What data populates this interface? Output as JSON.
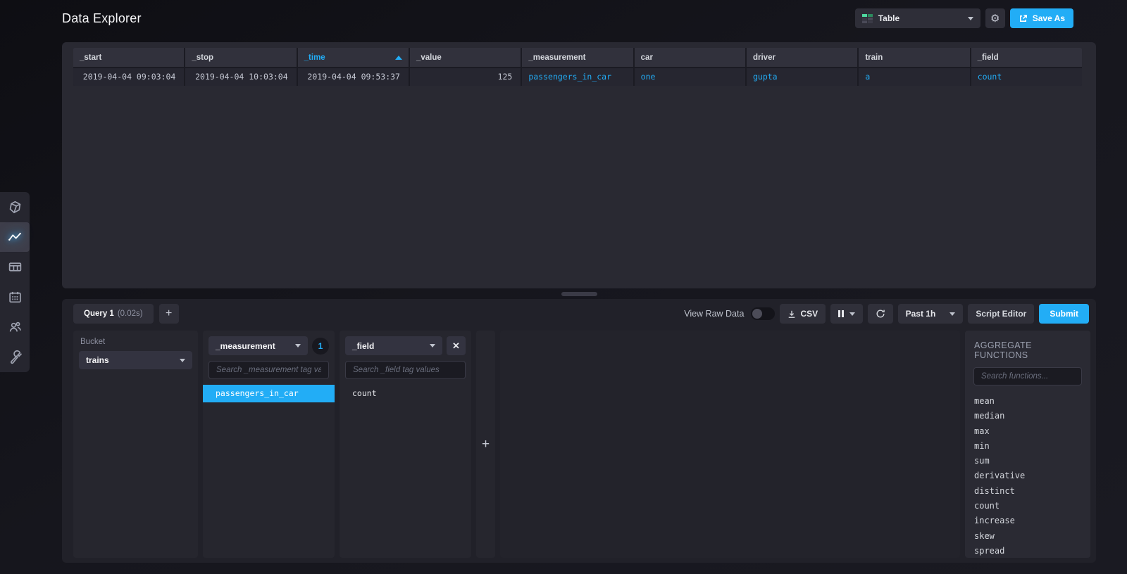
{
  "header": {
    "title": "Data Explorer",
    "view_type_label": "Table",
    "save_as_label": "Save As"
  },
  "sidebar": {
    "active_item": "data-explorer",
    "items": [
      "influxdb-logo",
      "data-explorer",
      "dashboards",
      "tasks",
      "organizations",
      "configuration"
    ]
  },
  "table": {
    "columns": [
      "_start",
      "_stop",
      "_time",
      "_value",
      "_measurement",
      "car",
      "driver",
      "train",
      "_field"
    ],
    "sorted_column": "_time",
    "numeric_columns": 4,
    "rows": [
      [
        "2019-04-04 09:03:04",
        "2019-04-04 10:03:04",
        "2019-04-04 09:53:37",
        "125",
        "passengers_in_car",
        "one",
        "gupta",
        "a",
        "count"
      ]
    ]
  },
  "query_panel": {
    "tab": {
      "name": "Query 1",
      "duration": "(0.02s)",
      "add_label": "+"
    },
    "controls": {
      "view_raw_label": "View Raw Data",
      "view_raw_on": false,
      "csv_label": "CSV",
      "time_range": "Past 1h",
      "script_editor_label": "Script Editor",
      "submit_label": "Submit"
    }
  },
  "builder": {
    "bucket": {
      "label": "Bucket",
      "selected": "trains"
    },
    "tag_columns": [
      {
        "key": "_measurement",
        "count_badge": "1",
        "search_placeholder": "Search _measurement tag values",
        "values": [
          {
            "name": "passengers_in_car",
            "selected": true
          }
        ]
      },
      {
        "key": "_field",
        "search_placeholder": "Search _field tag values",
        "values": [
          {
            "name": "count",
            "selected": false
          }
        ]
      }
    ],
    "add_card_label": "+",
    "functions": {
      "title": "AGGREGATE FUNCTIONS",
      "search_placeholder": "Search functions...",
      "items": [
        "mean",
        "median",
        "max",
        "min",
        "sum",
        "derivative",
        "distinct",
        "count",
        "increase",
        "skew",
        "spread"
      ]
    }
  },
  "colors": {
    "accent": "#22ADF6",
    "selected_row": "#22ADF6"
  }
}
